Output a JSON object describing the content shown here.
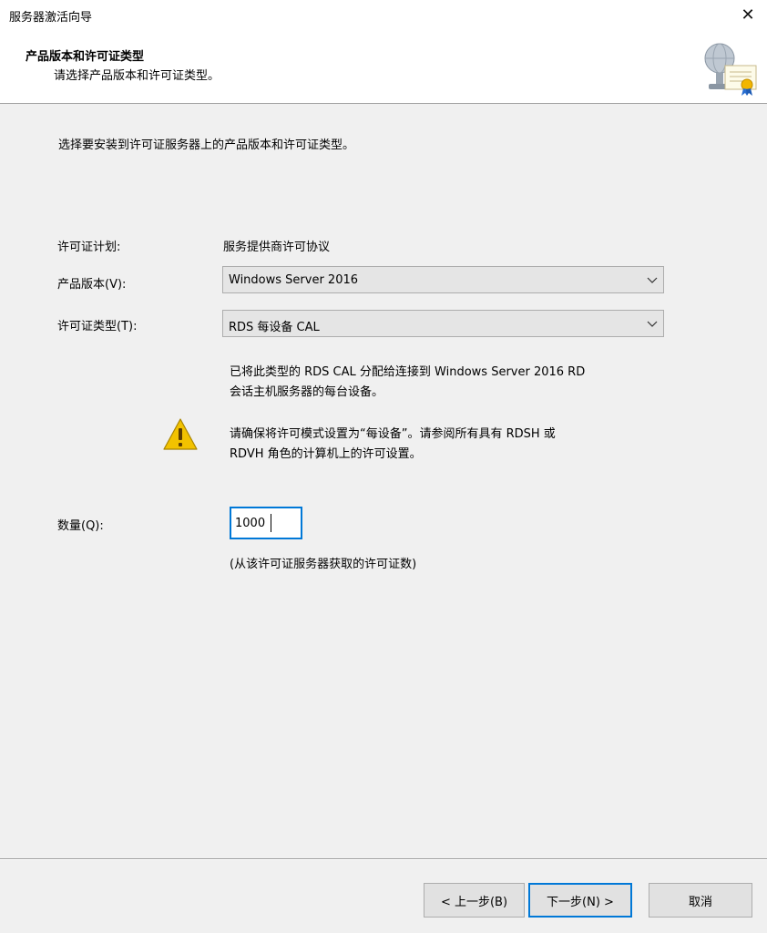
{
  "window": {
    "title": "服务器激活向导",
    "close_glyph": "✕"
  },
  "header": {
    "title": "产品版本和许可证类型",
    "subtitle": "请选择产品版本和许可证类型。",
    "icon": "license-certificate-icon"
  },
  "main": {
    "instruction": "选择要安装到许可证服务器上的产品版本和许可证类型。",
    "license_program": {
      "label": "许可证计划:",
      "value": "服务提供商许可协议"
    },
    "product_version": {
      "label": "产品版本(V):",
      "selected": "Windows Server 2016"
    },
    "license_type": {
      "label": "许可证类型(T):",
      "selected": "RDS 每设备 CAL"
    },
    "info_line1": "已将此类型的 RDS CAL 分配给连接到 Windows Server 2016 RD",
    "info_line2": "会话主机服务器的每台设备。",
    "warning_line1": "请确保将许可模式设置为“每设备”。请参阅所有具有 RDSH 或",
    "warning_line2": "RDVH 角色的计算机上的许可设置。",
    "quantity": {
      "label": "数量(Q):",
      "value": "1000",
      "hint": "(从该许可证服务器获取的许可证数)"
    }
  },
  "footer": {
    "back_label": "< 上一步(B)",
    "next_label": "下一步(N) >",
    "cancel_label": "取消"
  },
  "colors": {
    "focus_accent": "#0078d7",
    "window_bg": "#f0f0f0",
    "header_bg": "#ffffff",
    "button_bg": "#e1e1e1",
    "combo_bg": "#e5e5e5",
    "warning_yellow": "#f2c200"
  }
}
